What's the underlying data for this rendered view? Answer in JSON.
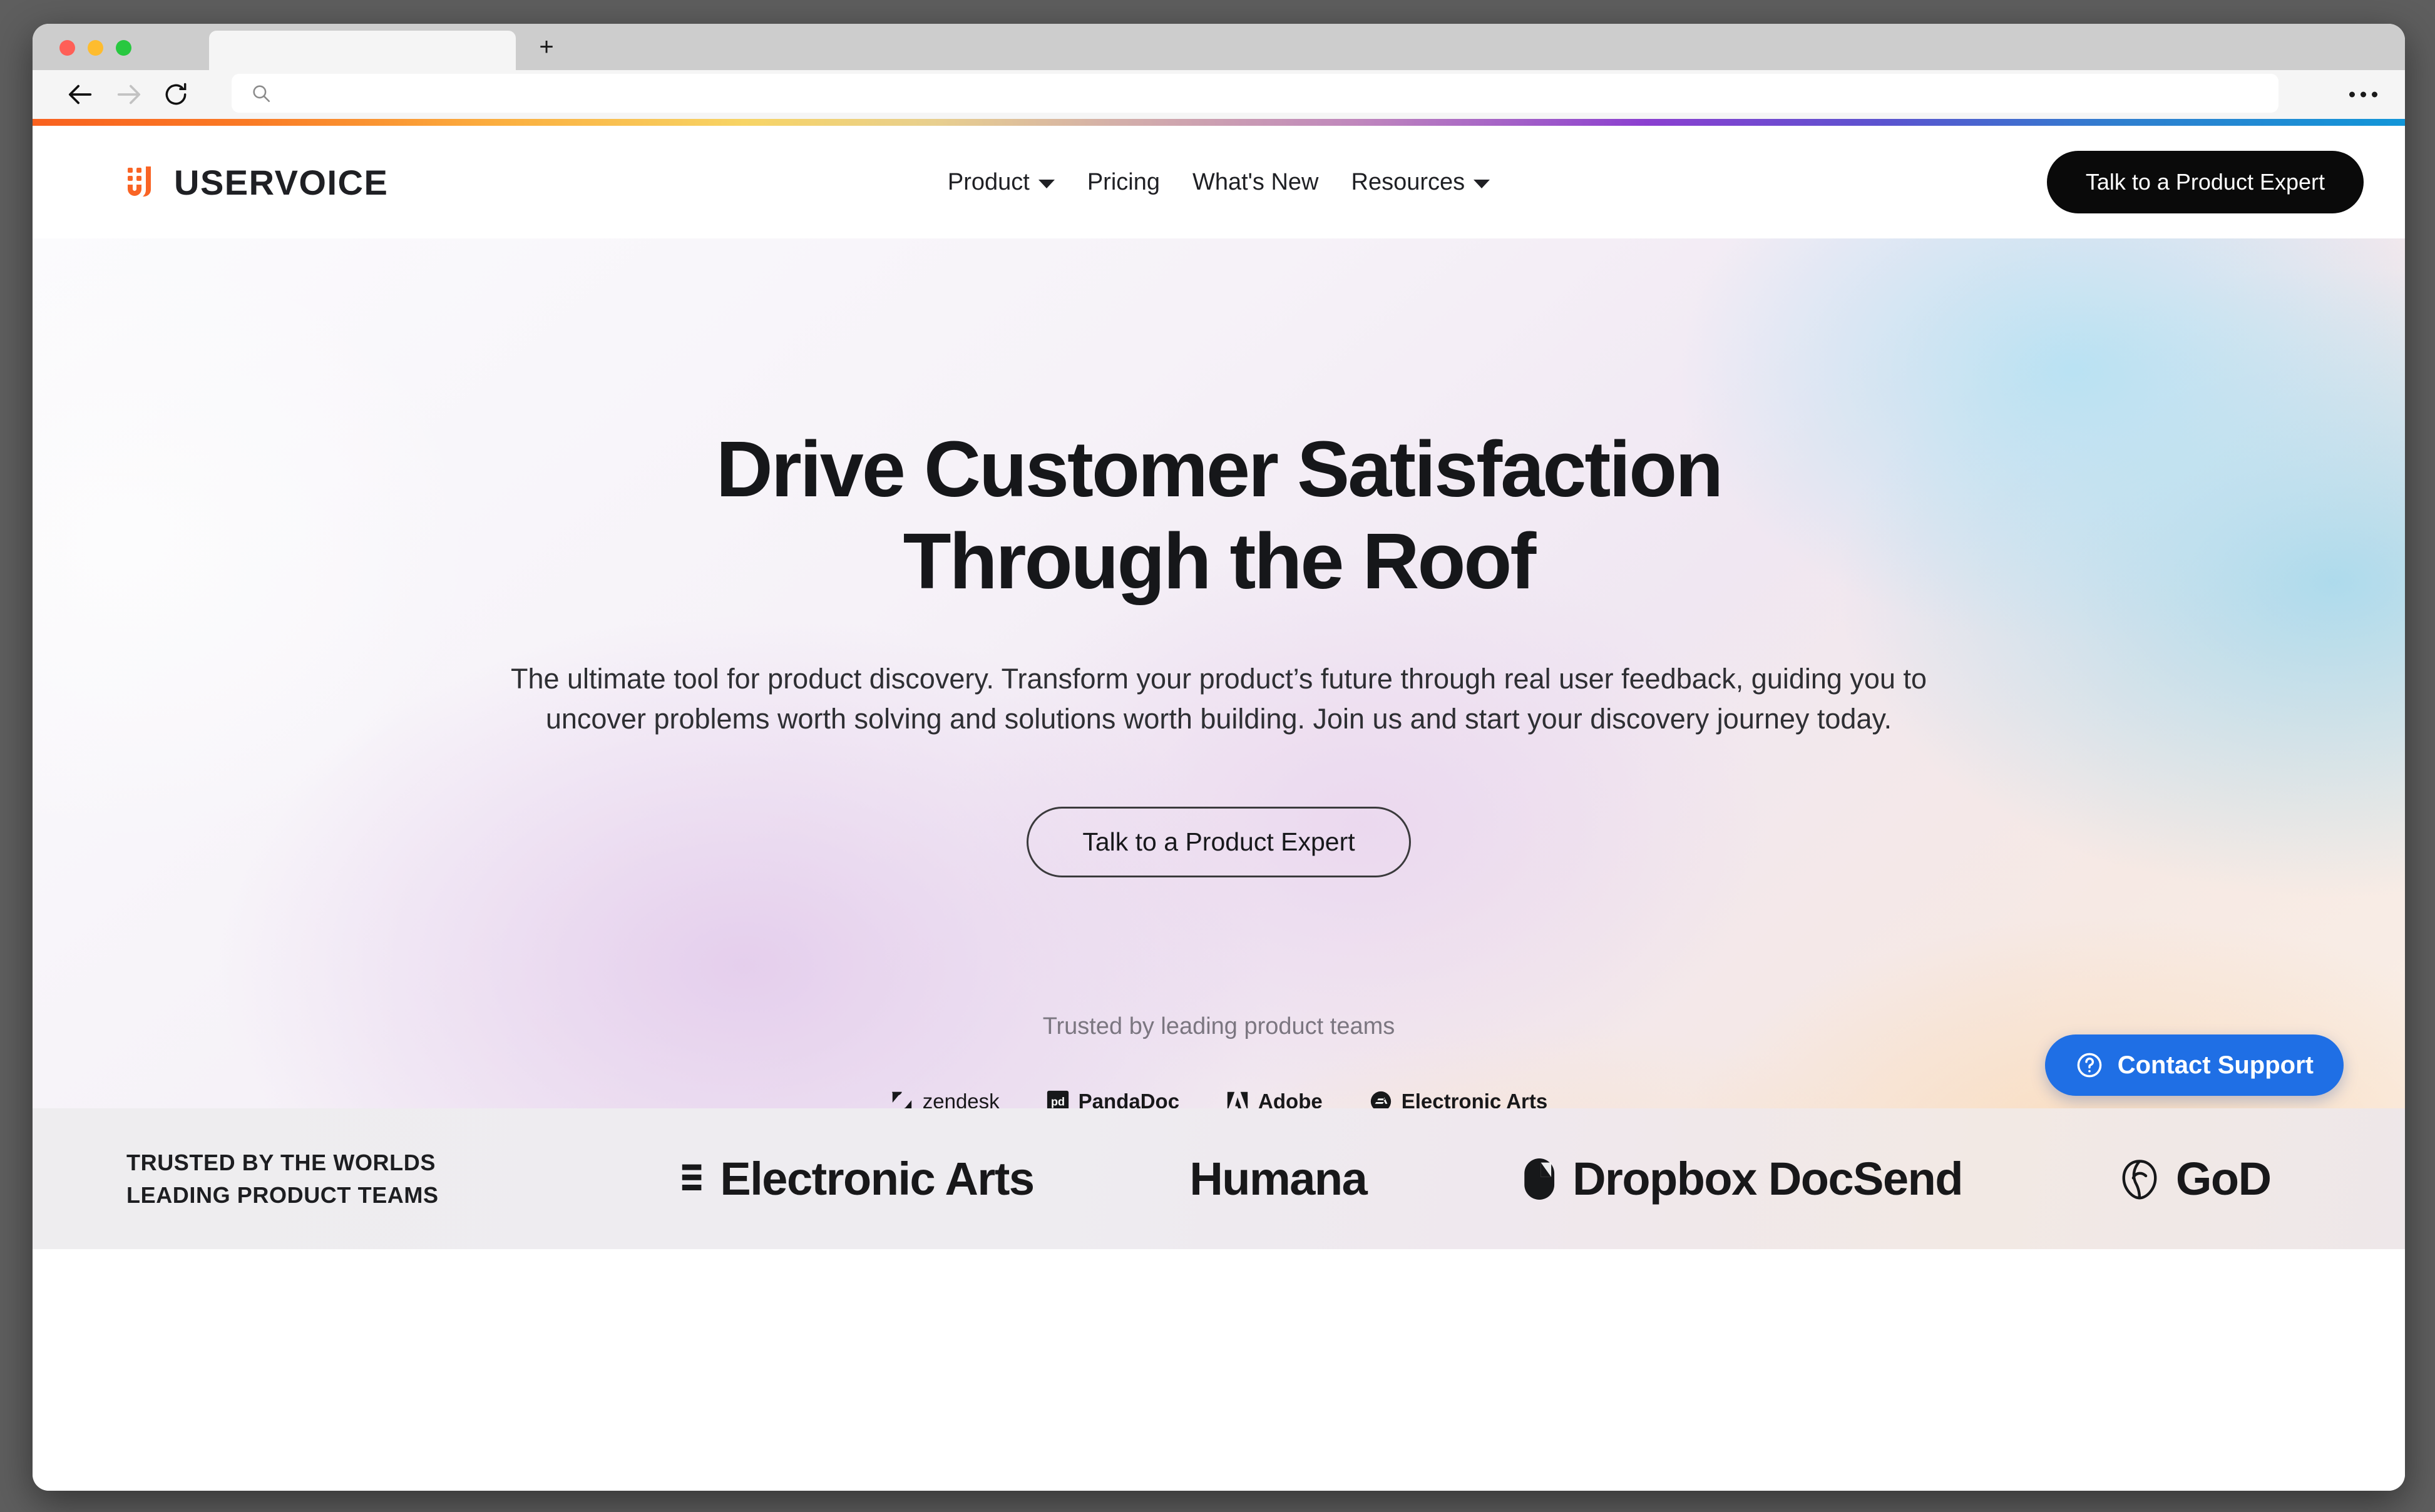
{
  "browser": {
    "tab_title": "",
    "new_tab_label": "+",
    "address_value": "",
    "address_placeholder": "",
    "icons": {
      "back": "back-arrow-icon",
      "forward": "forward-arrow-icon",
      "reload": "reload-icon",
      "search": "search-icon",
      "menu": "overflow-menu-icon"
    },
    "traffic_lights": [
      "close",
      "minimize",
      "zoom"
    ]
  },
  "site": {
    "brand": {
      "wordmark": "USERVOICE",
      "mark_color": "#f96425"
    },
    "nav": [
      {
        "label": "Product",
        "has_dropdown": true
      },
      {
        "label": "Pricing",
        "has_dropdown": false
      },
      {
        "label": "What's New",
        "has_dropdown": false
      },
      {
        "label": "Resources",
        "has_dropdown": true
      }
    ],
    "header_cta": "Talk to a Product Expert"
  },
  "hero": {
    "title_line1": "Drive Customer Satisfaction",
    "title_line2": "Through the Roof",
    "subtitle": "The ultimate tool for product discovery. Transform your product’s future through real user feedback, guiding you to uncover problems worth solving and solutions worth building. Join us and start your discovery journey today.",
    "cta": "Talk to a Product Expert",
    "trusted_label": "Trusted by leading product teams",
    "logos": [
      {
        "name": "zendesk",
        "style": "light"
      },
      {
        "name": "PandaDoc",
        "style": "bold"
      },
      {
        "name": "Adobe",
        "style": "bold"
      },
      {
        "name": "Electronic Arts",
        "style": "bold"
      }
    ]
  },
  "support_widget": {
    "label": "Contact Support",
    "icon": "question-circle-icon",
    "color": "#1f6fe5"
  },
  "trust_band": {
    "label": "TRUSTED BY THE WORLDS\nLEADING PRODUCT TEAMS",
    "logos": [
      {
        "name": "Electronic Arts",
        "mark": "ea-bars"
      },
      {
        "name": "Humana",
        "mark": "none"
      },
      {
        "name": "Dropbox DocSend",
        "mark": "dropbox-pill"
      },
      {
        "name": "GoD",
        "mark": "god-leaf"
      }
    ]
  },
  "colors": {
    "brand_orange": "#f96425",
    "header_cta_bg": "#0a0a0a",
    "support_blue": "#1f6fe5",
    "text_dark": "#16171a",
    "text_muted": "#7b7680"
  }
}
